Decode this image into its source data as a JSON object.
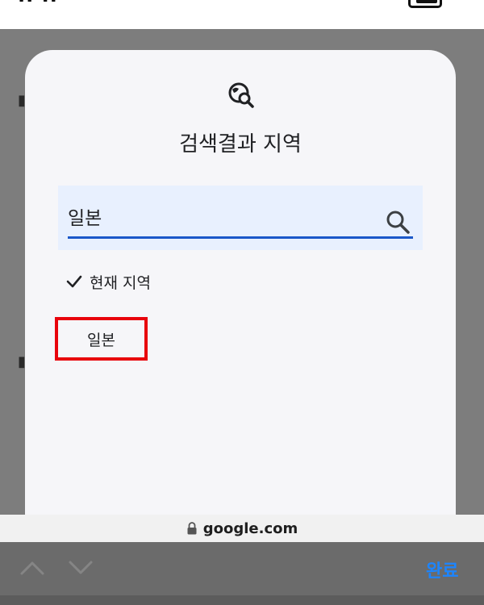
{
  "dialog": {
    "title": "검색결과 지역",
    "search_value": "일본",
    "current_region_label": "현재 지역",
    "results": [
      "일본"
    ]
  },
  "browser": {
    "url": "google.com",
    "done_label": "완료"
  },
  "colors": {
    "accent": "#1a57c9",
    "highlight_box": "#e8030c",
    "done": "#1c85ff"
  }
}
